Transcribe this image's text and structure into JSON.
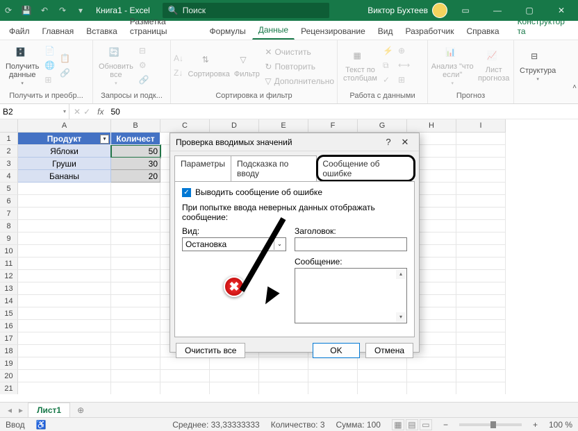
{
  "titlebar": {
    "title": "Книга1 - Excel",
    "search_placeholder": "Поиск",
    "user": "Виктор Бухтеев"
  },
  "menu_tabs": {
    "file": "Файл",
    "home": "Главная",
    "insert": "Вставка",
    "layout": "Разметка страницы",
    "formulas": "Формулы",
    "data": "Данные",
    "review": "Рецензирование",
    "view": "Вид",
    "developer": "Разработчик",
    "help": "Справка",
    "table_design": "Конструктор та"
  },
  "ribbon": {
    "get_data": "Получить\nданные",
    "g1_label": "Получить и преобр...",
    "refresh_all": "Обновить\nвсе",
    "g2_label": "Запросы и подк...",
    "sort": "Сортировка",
    "filter": "Фильтр",
    "clear": "Очистить",
    "reapply": "Повторить",
    "advanced": "Дополнительно",
    "g3_label": "Сортировка и фильтр",
    "text_to_cols": "Текст по\nстолбцам",
    "g4_label": "Работа с данными",
    "whatif": "Анализ \"что\nесли\"",
    "forecast": "Лист\nпрогноза",
    "g5_label": "Прогноз",
    "outline": "Структура"
  },
  "namebox": {
    "ref": "B2",
    "formula": "50"
  },
  "columns": [
    "A",
    "B",
    "C",
    "D",
    "E",
    "F",
    "G",
    "H",
    "I"
  ],
  "table": {
    "headers": {
      "a": "Продукт",
      "b": "Количест"
    },
    "rows": [
      {
        "a": "Яблоки",
        "b": "50"
      },
      {
        "a": "Груши",
        "b": "30"
      },
      {
        "a": "Бананы",
        "b": "20"
      }
    ]
  },
  "dialog": {
    "title": "Проверка вводимых значений",
    "tabs": {
      "params": "Параметры",
      "input_msg": "Подсказка по вводу",
      "error_msg": "Сообщение об ошибке"
    },
    "show_error_chk": "Выводить сообщение об ошибке",
    "on_invalid_label": "При попытке ввода неверных данных отображать сообщение:",
    "type_label": "Вид:",
    "type_value": "Остановка",
    "title_label": "Заголовок:",
    "msg_label": "Сообщение:",
    "clear_all": "Очистить все",
    "ok": "OK",
    "cancel": "Отмена"
  },
  "sheets": {
    "sheet1": "Лист1"
  },
  "status": {
    "mode": "Ввод",
    "avg_label": "Среднее:",
    "avg": "33,33333333",
    "count_label": "Количество:",
    "count": "3",
    "sum_label": "Сумма:",
    "sum": "100",
    "zoom": "100 %"
  }
}
